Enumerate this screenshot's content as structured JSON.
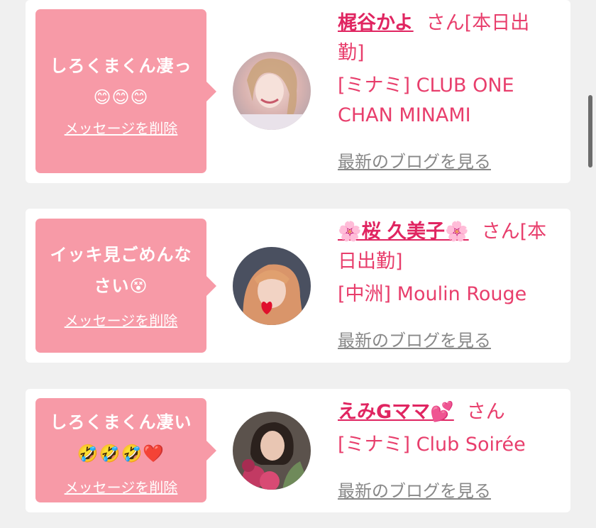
{
  "colors": {
    "background": "#f0f0f0",
    "card": "#ffffff",
    "bubble": "#f79aa7",
    "name": "#e02561",
    "text_pink": "#e83e6c",
    "blog_link": "#888888"
  },
  "cards": [
    {
      "message": "しろくまくん凄っ😊😊😊",
      "delete_label": "メッセージを削除",
      "name": "梶谷かよ",
      "suffix": "さん[本日出勤]",
      "shop": "[ミナミ] CLUB ONE CHAN MINAMI",
      "blog_label": "最新のブログを見る",
      "avatar_icon": "avatar-photo"
    },
    {
      "message": "イッキ見ごめんなさい😵",
      "delete_label": "メッセージを削除",
      "name": "🌸桜 久美子🌸",
      "suffix": "さん[本日出勤]",
      "shop": "[中洲] Moulin Rouge",
      "blog_label": "最新のブログを見る",
      "avatar_icon": "avatar-photo"
    },
    {
      "message": "しろくまくん凄い🤣🤣🤣❤️",
      "delete_label": "メッセージを削除",
      "name": "えみGママ💕",
      "suffix": "さん",
      "shop": "[ミナミ] Club Soirée",
      "blog_label": "最新のブログを見る",
      "avatar_icon": "avatar-photo"
    }
  ]
}
